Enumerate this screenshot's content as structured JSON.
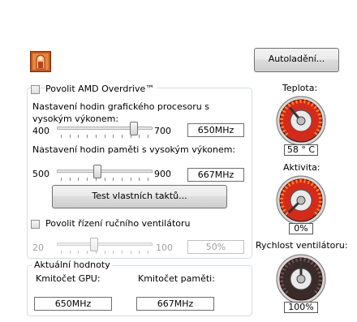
{
  "header": {
    "autoload_label": "Autoladění...",
    "app_icon": "overdrive-icon"
  },
  "overdrive": {
    "enable_label": "Povolit AMD Overdrive™",
    "gpu_clock_label": "Nastavení hodin grafického procesoru s vysokým výkonem:",
    "gpu_min": "400",
    "gpu_max": "700",
    "gpu_value": "650MHz",
    "gpu_fraction": 0.83,
    "mem_clock_label": "Nastavení hodin paměti s vysokým výkonem:",
    "mem_min": "500",
    "mem_max": "900",
    "mem_value": "667MHz",
    "mem_fraction": 0.42,
    "test_button_label": "Test vlastních taktů..."
  },
  "fan": {
    "enable_label": "Povolit řízení ručního ventilátoru",
    "min": "20",
    "max": "100",
    "value": "50%",
    "fraction": 0.375
  },
  "current": {
    "group_label": "Aktuální hodnoty",
    "gpu_label": "Kmitočet GPU:",
    "gpu_value": "650MHz",
    "mem_label": "Kmitočet paměti:",
    "mem_value": "667MHz"
  },
  "gauges": {
    "temp_label": "Teplota:",
    "temp_value": "58 ° C",
    "activity_label": "Aktivita:",
    "activity_value": "0%",
    "fan_label": "Rychlost ventilátoru:",
    "fan_value": "100%",
    "accent_color": "#d42a1a"
  }
}
